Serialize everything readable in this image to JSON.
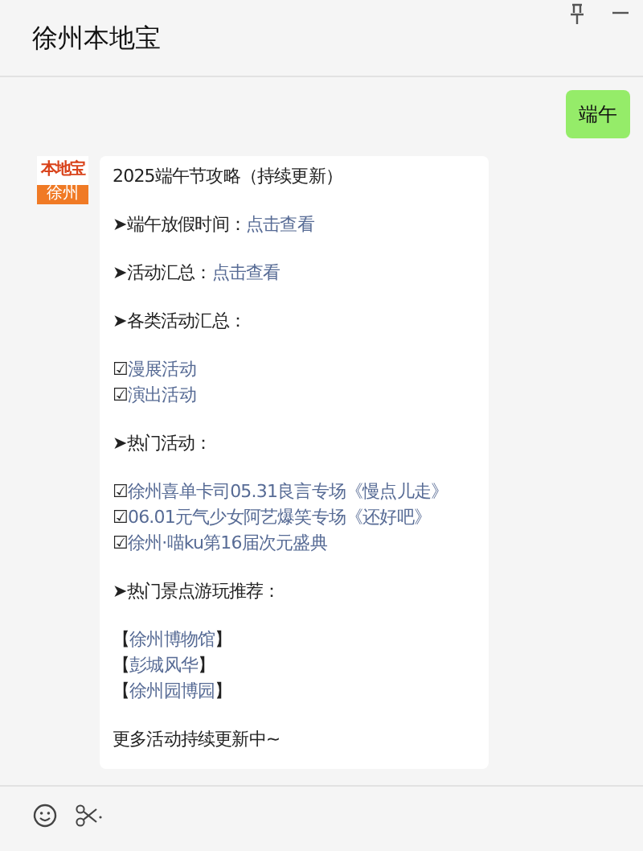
{
  "window": {
    "title": "徐州本地宝"
  },
  "sent_message": {
    "text": "端午"
  },
  "avatar": {
    "top": "本地宝",
    "bottom": "徐州"
  },
  "message_lines": [
    {
      "kind": "text",
      "text": "2025端午节攻略（持续更新）"
    },
    {
      "kind": "blank"
    },
    {
      "kind": "label_link",
      "label": "➤端午放假时间：",
      "link": "点击查看"
    },
    {
      "kind": "blank"
    },
    {
      "kind": "label_link",
      "label": "➤活动汇总：",
      "link": "点击查看"
    },
    {
      "kind": "blank"
    },
    {
      "kind": "text",
      "text": "➤各类活动汇总："
    },
    {
      "kind": "blank"
    },
    {
      "kind": "check_link",
      "mark": "☑",
      "link": "漫展活动"
    },
    {
      "kind": "check_link",
      "mark": "☑",
      "link": "演出活动"
    },
    {
      "kind": "blank"
    },
    {
      "kind": "text",
      "text": "➤热门活动："
    },
    {
      "kind": "blank"
    },
    {
      "kind": "check_link",
      "mark": "☑",
      "link": "徐州喜单卡司05.31良言专场《慢点儿走》"
    },
    {
      "kind": "check_link",
      "mark": "☑",
      "link": "06.01元气少女阿艺爆笑专场《还好吧》"
    },
    {
      "kind": "check_link",
      "mark": "☑",
      "link": "徐州·喵ku第16届次元盛典"
    },
    {
      "kind": "blank"
    },
    {
      "kind": "text",
      "text": "➤热门景点游玩推荐："
    },
    {
      "kind": "blank"
    },
    {
      "kind": "bracket_link",
      "open": "【",
      "link": "徐州博物馆",
      "close": "】"
    },
    {
      "kind": "bracket_link",
      "open": "【",
      "link": "彭城风华",
      "close": "】"
    },
    {
      "kind": "bracket_link",
      "open": "【",
      "link": "徐州园博园",
      "close": "】"
    },
    {
      "kind": "blank"
    },
    {
      "kind": "text",
      "text": "更多活动持续更新中~"
    }
  ]
}
